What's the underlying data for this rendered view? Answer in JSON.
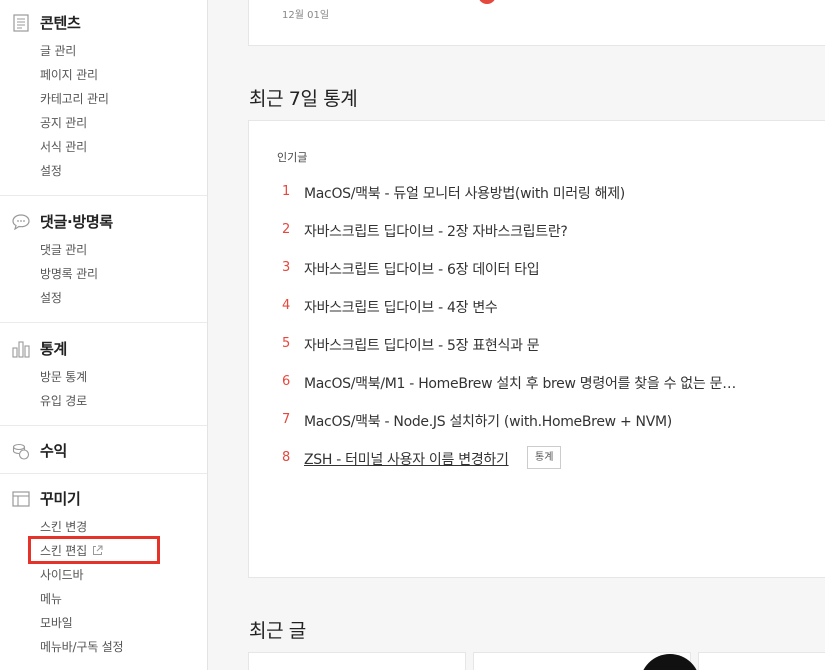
{
  "sidebar": {
    "contents": {
      "title": "콘텐츠",
      "items": [
        "글 관리",
        "페이지 관리",
        "카테고리 관리",
        "공지 관리",
        "서식 관리",
        "설정"
      ]
    },
    "comments": {
      "title": "댓글·방명록",
      "items": [
        "댓글 관리",
        "방명록 관리",
        "설정"
      ]
    },
    "stats": {
      "title": "통계",
      "items": [
        "방문 통계",
        "유입 경로"
      ]
    },
    "revenue": {
      "title": "수익"
    },
    "decorate": {
      "title": "꾸미기",
      "items": [
        "스킨 변경",
        "스킨 편집",
        "사이드바",
        "메뉴",
        "모바일",
        "메뉴바/구독 설정"
      ]
    }
  },
  "main": {
    "top_card_date": "12월  01일",
    "stats_heading": "최근 7일 통계",
    "popular_label": "인기글",
    "popular_posts": [
      {
        "rank": "1",
        "title": "MacOS/맥북 - 듀얼 모니터 사용방법(with 미러링 해제)"
      },
      {
        "rank": "2",
        "title": "자바스크립트 딥다이브 - 2장 자바스크립트란?"
      },
      {
        "rank": "3",
        "title": "자바스크립트 딥다이브 - 6장 데이터 타입"
      },
      {
        "rank": "4",
        "title": "자바스크립트 딥다이브 - 4장 변수"
      },
      {
        "rank": "5",
        "title": "자바스크립트 딥다이브 - 5장 표현식과 문"
      },
      {
        "rank": "6",
        "title": "MacOS/맥북/M1 - HomeBrew 설치 후 brew 명령어를 찾을 수 없는 문…"
      },
      {
        "rank": "7",
        "title": "MacOS/맥북 - Node.JS 설치하기 (with.HomeBrew + NVM)"
      },
      {
        "rank": "8",
        "title": "ZSH - 터미널 사용자 이름 변경하기"
      }
    ],
    "stats_badge": "통계",
    "recent_heading": "최근 글"
  },
  "colors": {
    "accent": "#e5483d",
    "highlight_box": "#e5332a"
  },
  "icons": {
    "contents": "document-icon",
    "comments": "speech-bubble-icon",
    "stats": "bar-chart-icon",
    "revenue": "coins-icon",
    "decorate": "layout-icon",
    "external": "external-link-icon"
  }
}
